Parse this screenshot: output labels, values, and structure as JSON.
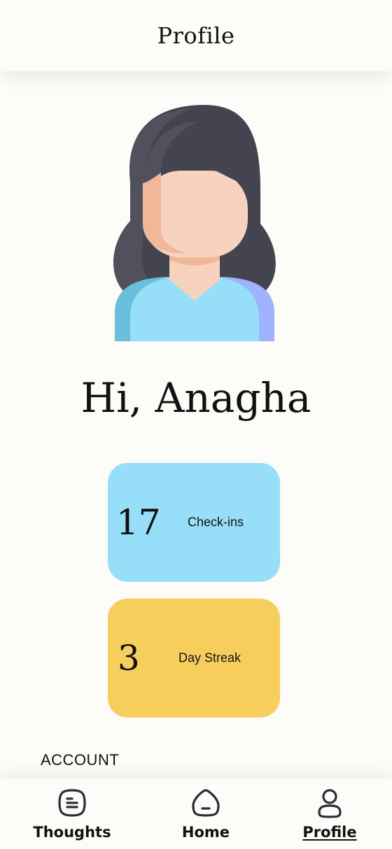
{
  "header": {
    "title": "Profile"
  },
  "user": {
    "greeting": "Hi, Anagha"
  },
  "stats": [
    {
      "value": "17",
      "label": "Check-ins",
      "color": "#97dff9"
    },
    {
      "value": "3",
      "label": "Day Streak",
      "color": "#f7ce5b"
    }
  ],
  "sections": {
    "account_label": "ACCOUNT"
  },
  "nav": {
    "items": [
      {
        "label": "Thoughts",
        "icon": "document-icon",
        "active": false
      },
      {
        "label": "Home",
        "icon": "home-icon",
        "active": false
      },
      {
        "label": "Profile",
        "icon": "user-icon",
        "active": true
      }
    ]
  },
  "colors": {
    "background": "#fefcf8",
    "checkins_card": "#97dff9",
    "streak_card": "#f7ce5b",
    "text": "#111111"
  }
}
